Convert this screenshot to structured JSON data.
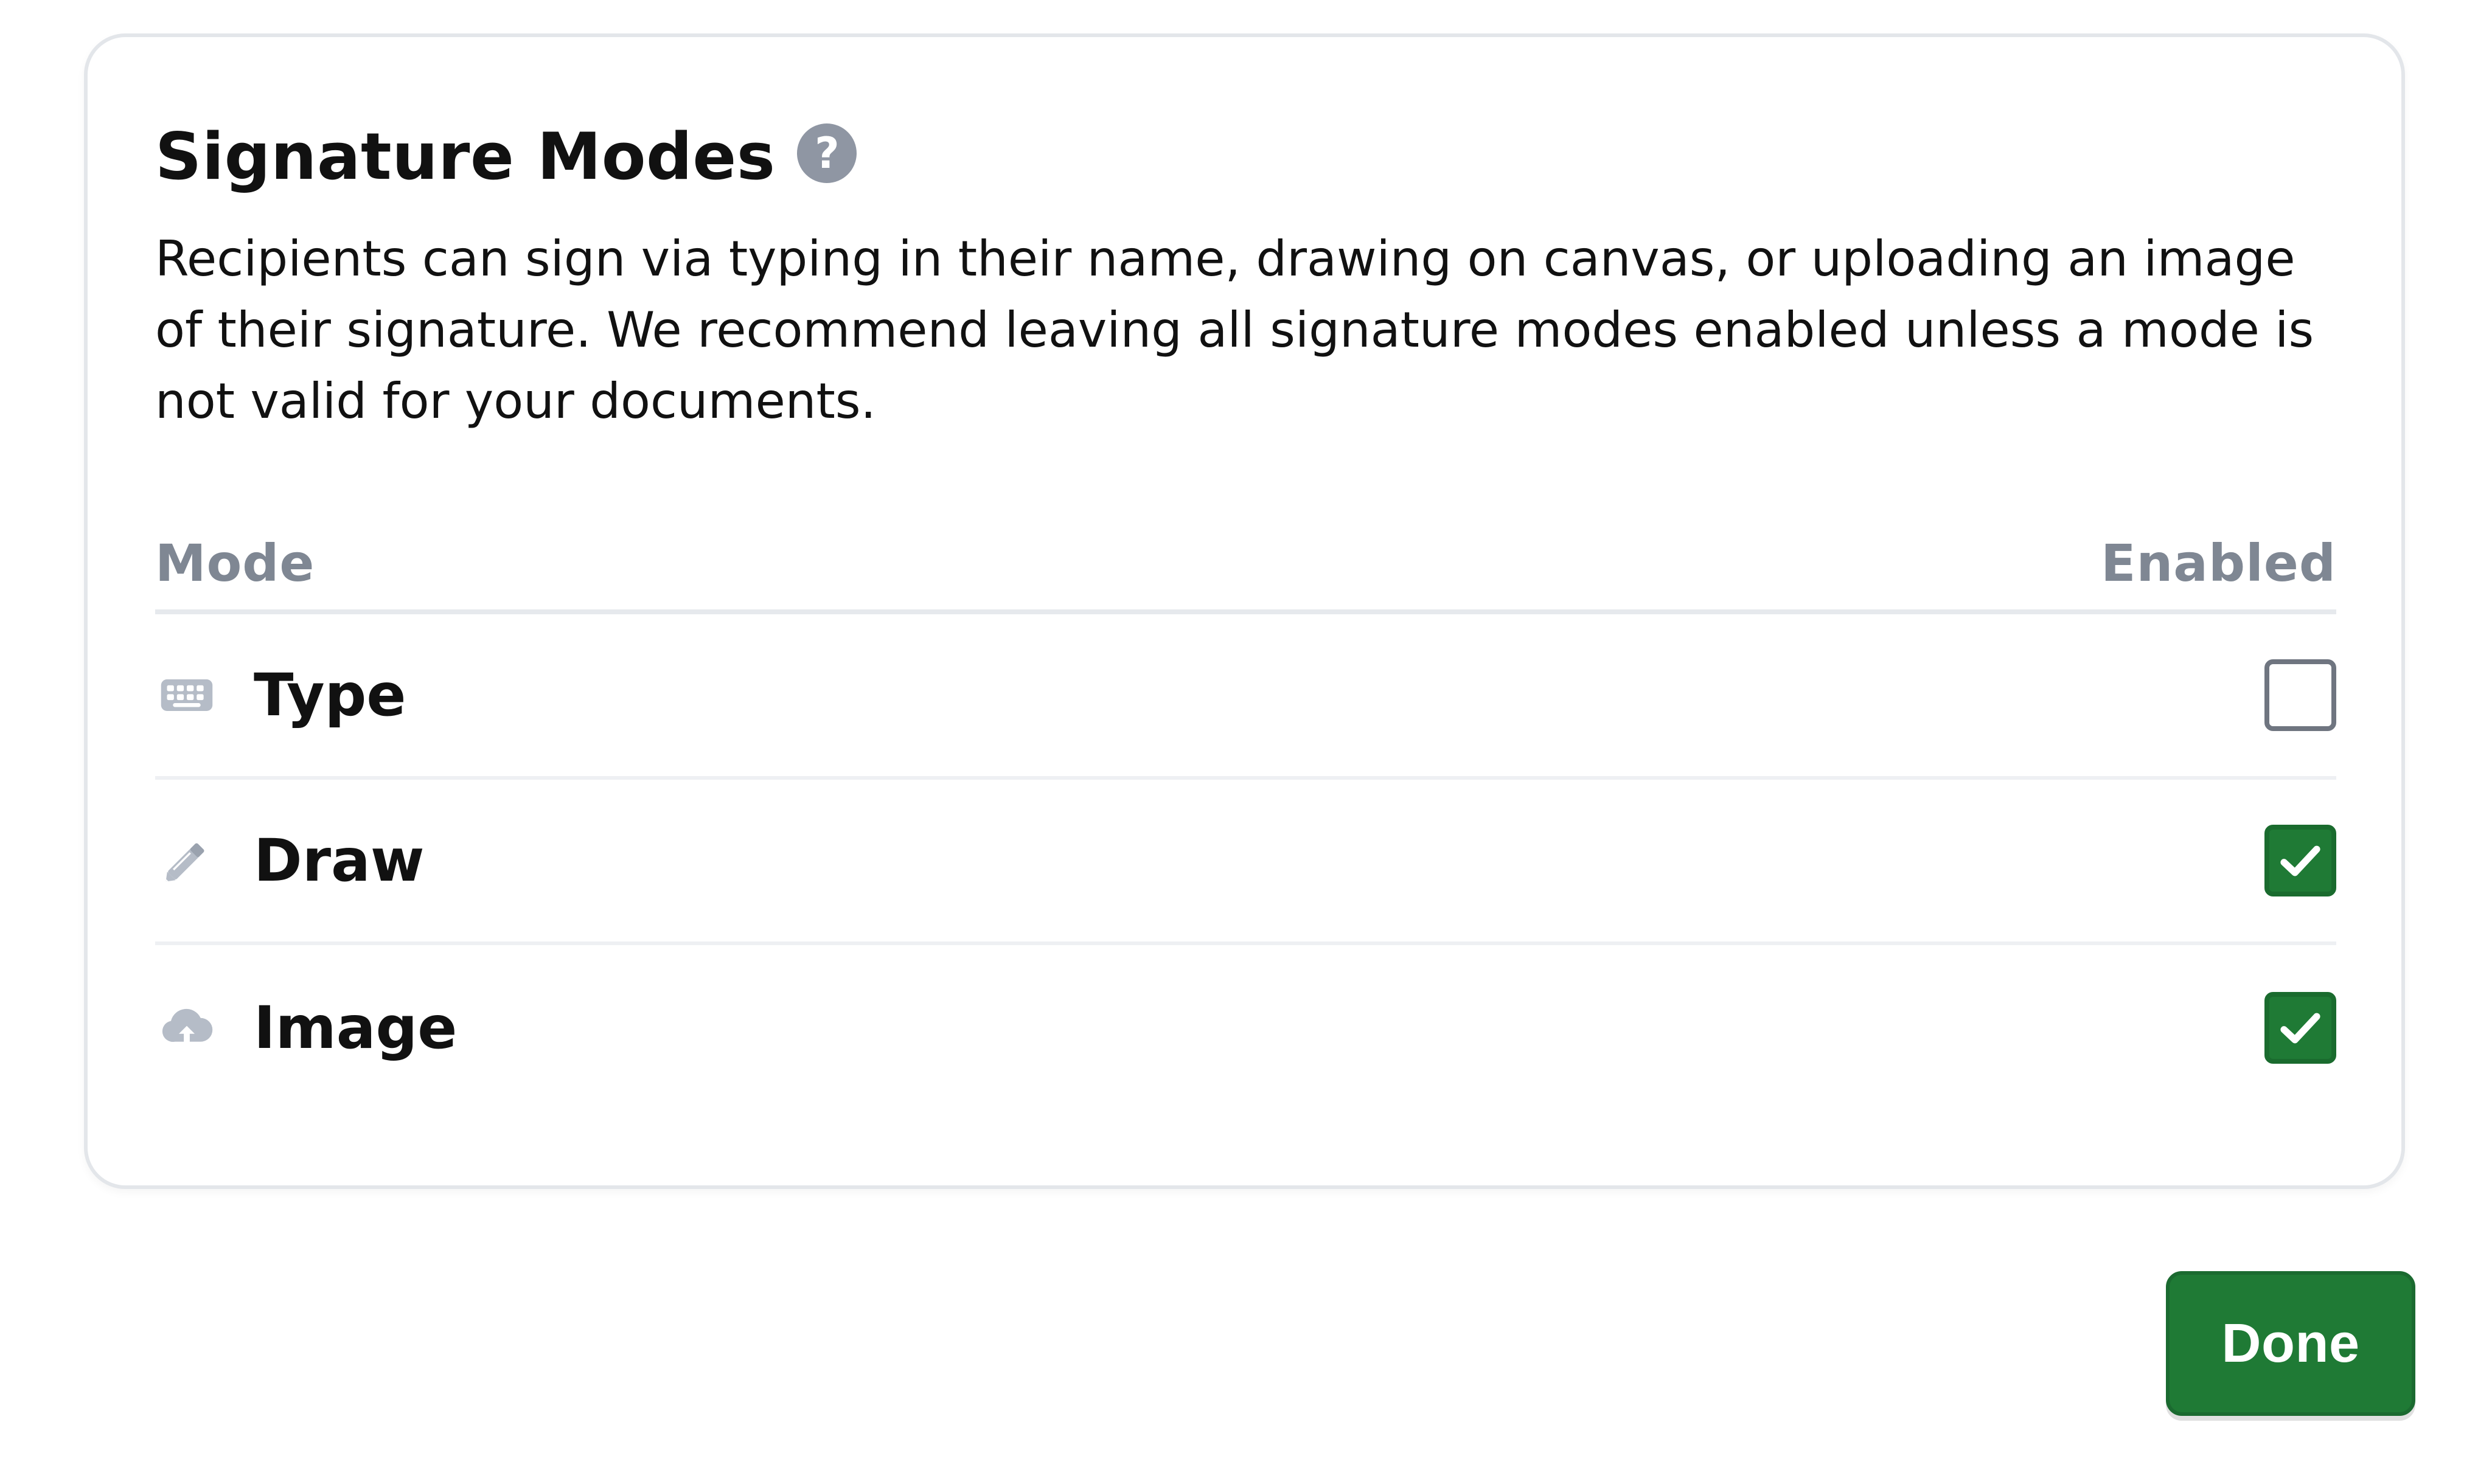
{
  "dialog": {
    "title": "Signature Modes",
    "help_icon": "question-circle-icon",
    "description": "Recipients can sign via typing in their name, drawing on canvas, or uploading an image of their signature. We recommend leaving all signature modes enabled unless a mode is not valid for your documents."
  },
  "table": {
    "headers": {
      "mode": "Mode",
      "enabled": "Enabled"
    },
    "rows": [
      {
        "label": "Type",
        "icon": "keyboard-icon",
        "enabled": false
      },
      {
        "label": "Draw",
        "icon": "pencil-icon",
        "enabled": true
      },
      {
        "label": "Image",
        "icon": "cloud-upload-icon",
        "enabled": true
      }
    ]
  },
  "actions": {
    "done_label": "Done"
  },
  "colors": {
    "accent_green": "#1f7a35",
    "muted_gray": "#7f8793",
    "icon_gray": "#8f96a3",
    "border_gray": "#e3e6ea"
  }
}
